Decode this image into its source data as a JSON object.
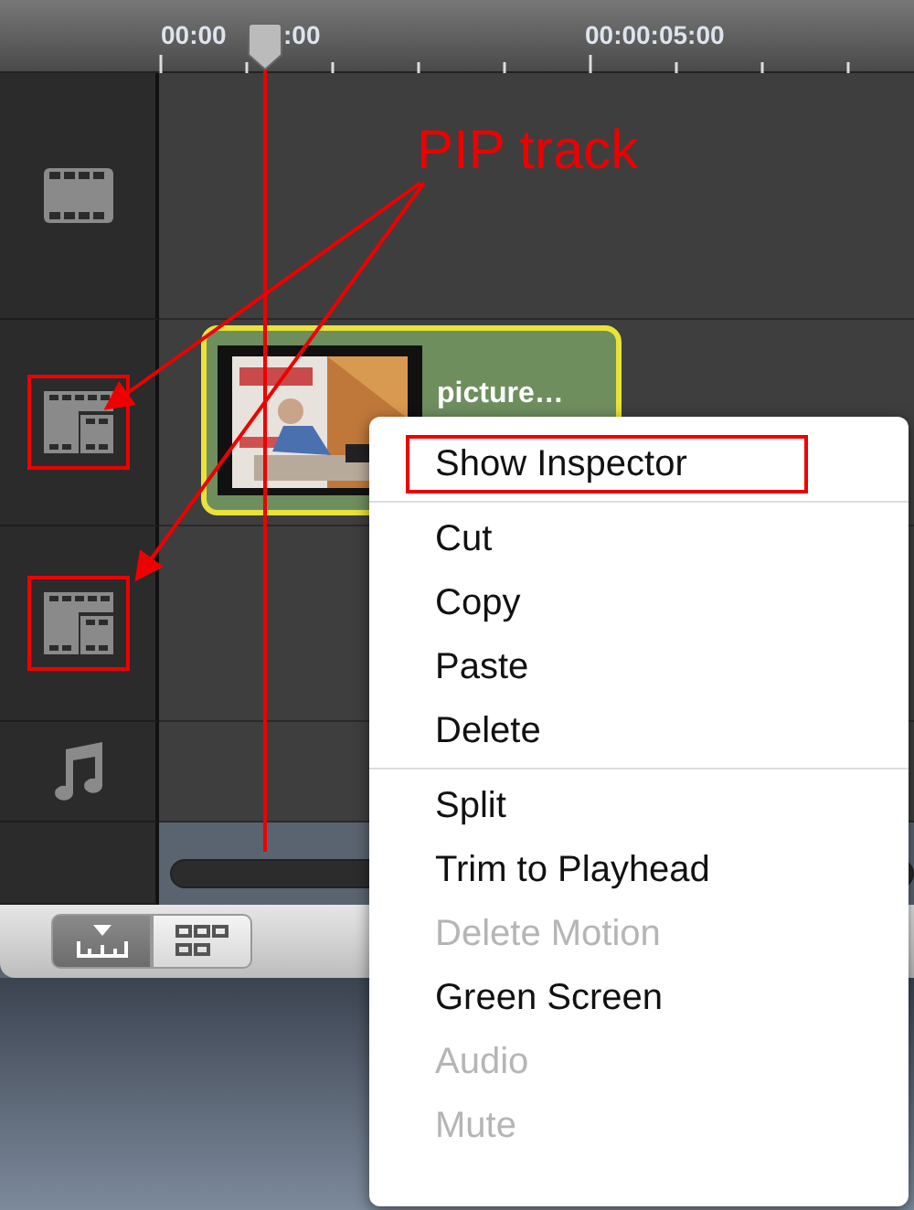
{
  "ruler": {
    "labels": [
      "00:00",
      ":00",
      "00:00:05:00"
    ]
  },
  "tracks": [
    {
      "kind": "video",
      "highlighted": false
    },
    {
      "kind": "pip",
      "highlighted": true
    },
    {
      "kind": "pip",
      "highlighted": true
    },
    {
      "kind": "audio",
      "highlighted": false
    }
  ],
  "clip": {
    "title": "picture…",
    "selected": true
  },
  "view_buttons": [
    {
      "selected": true
    },
    {
      "selected": false
    }
  ],
  "annotation": {
    "label": "PIP track"
  },
  "context_menu": {
    "items": [
      {
        "kind": "item",
        "label": "Show Inspector",
        "disabled": false,
        "highlighted": true
      },
      {
        "kind": "separator"
      },
      {
        "kind": "item",
        "label": "Cut",
        "disabled": false,
        "highlighted": false
      },
      {
        "kind": "item",
        "label": "Copy",
        "disabled": false,
        "highlighted": false
      },
      {
        "kind": "item",
        "label": "Paste",
        "disabled": false,
        "highlighted": false
      },
      {
        "kind": "item",
        "label": "Delete",
        "disabled": false,
        "highlighted": false
      },
      {
        "kind": "separator"
      },
      {
        "kind": "item",
        "label": "Split",
        "disabled": false,
        "highlighted": false
      },
      {
        "kind": "item",
        "label": "Trim to Playhead",
        "disabled": false,
        "highlighted": false
      },
      {
        "kind": "item",
        "label": "Delete Motion",
        "disabled": true,
        "highlighted": false
      },
      {
        "kind": "item",
        "label": "Green Screen",
        "disabled": false,
        "highlighted": false
      },
      {
        "kind": "item",
        "label": "Audio",
        "disabled": true,
        "highlighted": false
      },
      {
        "kind": "item",
        "label": "Mute",
        "disabled": true,
        "highlighted": false
      }
    ]
  }
}
